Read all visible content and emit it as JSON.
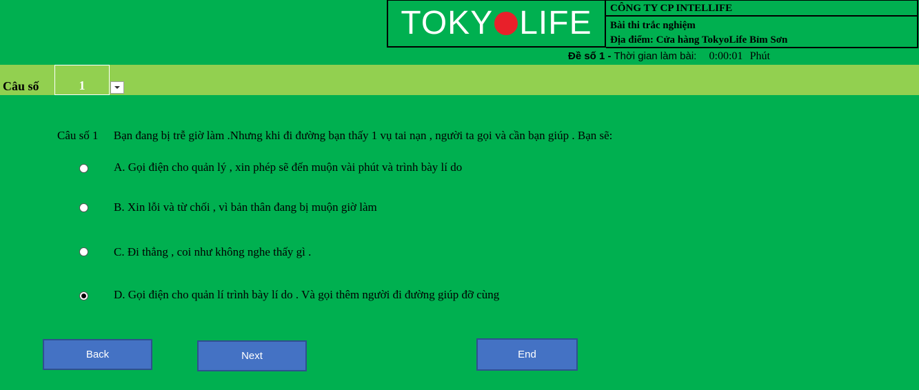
{
  "header": {
    "logo": {
      "left": "TOKY",
      "right": "LIFE"
    },
    "company": "CÔNG TY CP INTELLIFE",
    "exam_name": "Bài thi trắc nghiệm",
    "location": "Địa điểm: Cửa hàng TokyoLife Bỉm Sơn",
    "exam_code": "Đề số 1 -",
    "time_label": "Thời gian làm bài:",
    "time_value": "0:00:01",
    "time_unit": "Phút"
  },
  "selector": {
    "label": "Câu số",
    "value": "1"
  },
  "question": {
    "number": "Câu số 1",
    "text": "Bạn đang bị trễ giờ làm .Nhưng  khi đi đường bạn thấy 1 vụ tai nạn , người ta gọi và cần bạn giúp . Bạn sẽ:"
  },
  "options": [
    {
      "text": "A. Gọi điện cho quản lý , xin phép sẽ đến muộn vài phút và trình bày lí do",
      "selected": false
    },
    {
      "text": "B. Xin lỗi và từ chối , vì bản thân đang bị muộn giờ làm",
      "selected": false
    },
    {
      "text": "C. Đi thẳng , coi như không nghe thấy gì .",
      "selected": false
    },
    {
      "text": "D. Gọi điện cho quản lí trình bày lí do . Và gọi thêm người đi đường giúp đỡ cùng",
      "selected": true
    }
  ],
  "buttons": {
    "back": "Back",
    "next": "Next",
    "end": "End"
  },
  "colors": {
    "background": "#00b050",
    "band": "#92d050",
    "button": "#4472c4",
    "logo_dot": "#e8202a"
  }
}
